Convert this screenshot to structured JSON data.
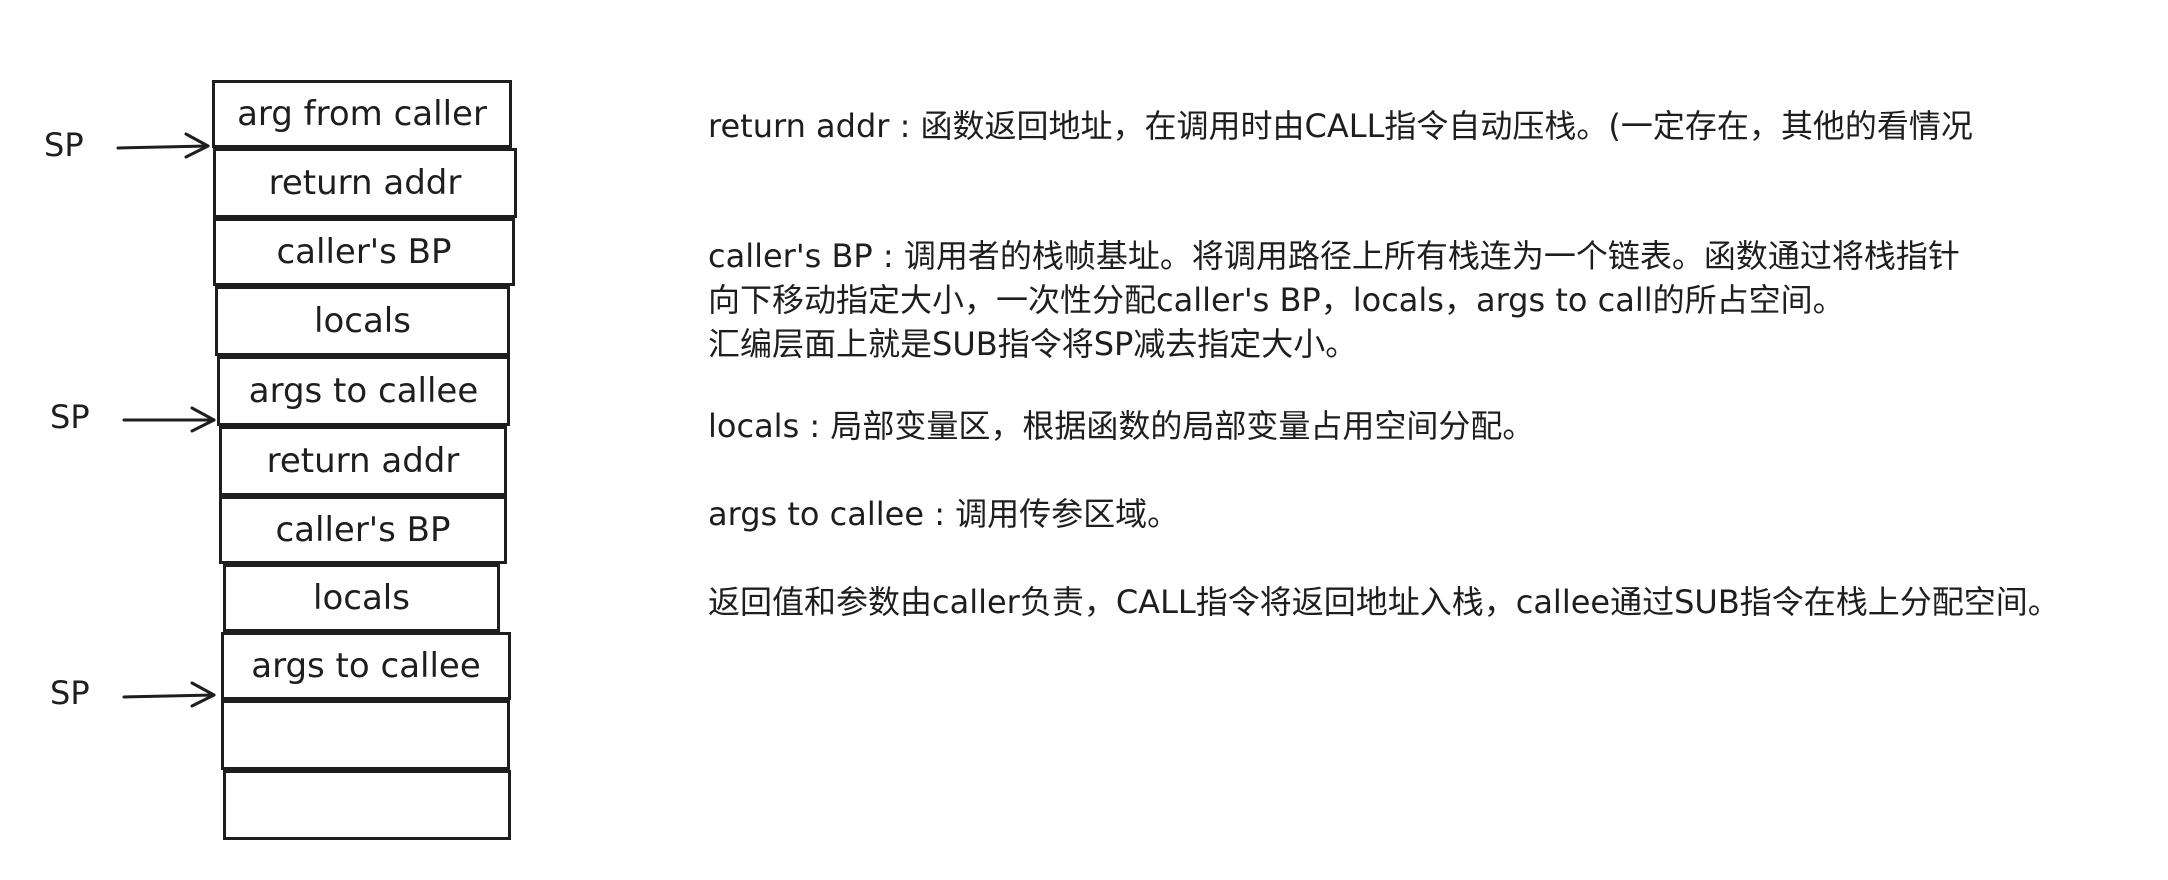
{
  "stack": {
    "boxes": [
      "arg from caller",
      "return addr",
      "caller's BP",
      "locals",
      "args to callee",
      "return addr",
      "caller's BP",
      "locals",
      "args to callee",
      "",
      ""
    ]
  },
  "pointers": {
    "sp1": "SP",
    "sp2": "SP",
    "sp3": "SP"
  },
  "notes": {
    "return_addr": "return addr : 函数返回地址，在调用时由CALL指令自动压栈。(一定存在，其他的看情况",
    "callers_bp": {
      "line1": "caller's BP : 调用者的栈帧基址。将调用路径上所有栈连为一个链表。函数通过将栈指针",
      "line2": "向下移动指定大小，一次性分配caller's BP，locals，args to call的所占空间。",
      "line3": "汇编层面上就是SUB指令将SP减去指定大小。"
    },
    "locals": "locals : 局部变量区，根据函数的局部变量占用空间分配。",
    "args_to_callee": "args to callee : 调用传参区域。",
    "summary": "返回值和参数由caller负责，CALL指令将返回地址入栈，callee通过SUB指令在栈上分配空间。"
  }
}
